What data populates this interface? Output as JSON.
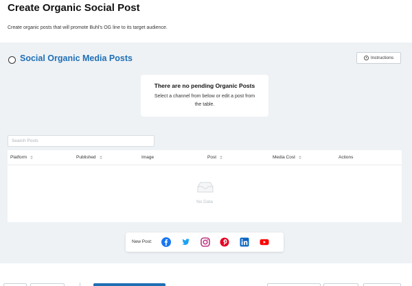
{
  "page": {
    "title": "Create Organic Social Post",
    "subtitle": "Create organic posts that will promote Buhl's OG line to its target audience."
  },
  "section": {
    "title": "Social Organic Media Posts",
    "instructions_label": "Instructions"
  },
  "empty_state": {
    "title": "There are no pending Organic Posts",
    "text": "Select a channel from below or edit a post from the table."
  },
  "search": {
    "placeholder": "Search Posts",
    "value": ""
  },
  "table": {
    "columns": [
      {
        "label": "Platform",
        "sortable": true
      },
      {
        "label": "Published",
        "sortable": true
      },
      {
        "label": "Image",
        "sortable": false
      },
      {
        "label": "Post",
        "sortable": true
      },
      {
        "label": "Media Cost",
        "sortable": true
      },
      {
        "label": "Actions",
        "sortable": false
      }
    ],
    "empty_text": "No Data"
  },
  "new_post": {
    "label": "New Post:",
    "channels": [
      {
        "name": "facebook-icon",
        "color": "#1877f2"
      },
      {
        "name": "twitter-icon",
        "color": "#1da1f2"
      },
      {
        "name": "instagram-icon",
        "color": "#c13584"
      },
      {
        "name": "pinterest-icon",
        "color": "#e60023"
      },
      {
        "name": "linkedin-icon",
        "color": "#0a66c2"
      },
      {
        "name": "youtube-icon",
        "color": "#ff0000"
      }
    ]
  },
  "colors": {
    "accent": "#1f6fb5",
    "section_background": "#eef2f5"
  }
}
